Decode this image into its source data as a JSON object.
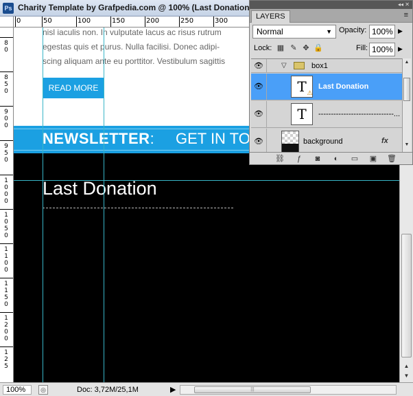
{
  "window": {
    "app_badge": "Ps",
    "title": "Charity Template by Grafpedia.com @ 100% (Last Donation,"
  },
  "rulers": {
    "top_ticks": [
      "0",
      "50",
      "100",
      "150",
      "200",
      "250",
      "300"
    ],
    "left_labels": [
      "8\n0",
      "8\n5\n0",
      "9\n0\n0",
      "9\n5\n0",
      "1\n0\n0\n0",
      "1\n0\n5\n0",
      "1\n1\n0\n0",
      "1\n1\n5\n0",
      "1\n2\n0\n0",
      "1\n2\n5"
    ]
  },
  "canvas": {
    "body_lines": [
      "nisl iaculis non. In vulputate lacus ac risus rutrum",
      "egestas quis et purus. Nulla facilisi. Donec adipi-",
      "scing aliquam ante eu porttitor. Vestibulum sagittis"
    ],
    "read_more": "READ MORE",
    "newsletter_label": "NEWSLETTER",
    "newsletter_colon": ":",
    "newsletter_cta": "GET IN TO",
    "section_title": "Last Donation",
    "accent_color": "#1ba0e2"
  },
  "status_bar": {
    "zoom": "100%",
    "doc_info": "Doc: 3,72M/25,1M"
  },
  "layers_panel": {
    "tab_label": "LAYERS",
    "blend_mode": "Normal",
    "opacity_label": "Opacity:",
    "opacity_value": "100%",
    "lock_label": "Lock:",
    "fill_label": "Fill:",
    "fill_value": "100%",
    "layers": [
      {
        "name": "box1",
        "type": "group",
        "visible": true,
        "expanded": true
      },
      {
        "name": "Last Donation",
        "type": "text",
        "visible": true,
        "selected": true,
        "warning": true
      },
      {
        "name": "------------------------------...",
        "type": "text",
        "visible": true
      },
      {
        "name": "background",
        "type": "pixel",
        "visible": true,
        "has_fx": true
      }
    ],
    "fx_label": "fx",
    "selection_color": "#4a9ff8"
  }
}
